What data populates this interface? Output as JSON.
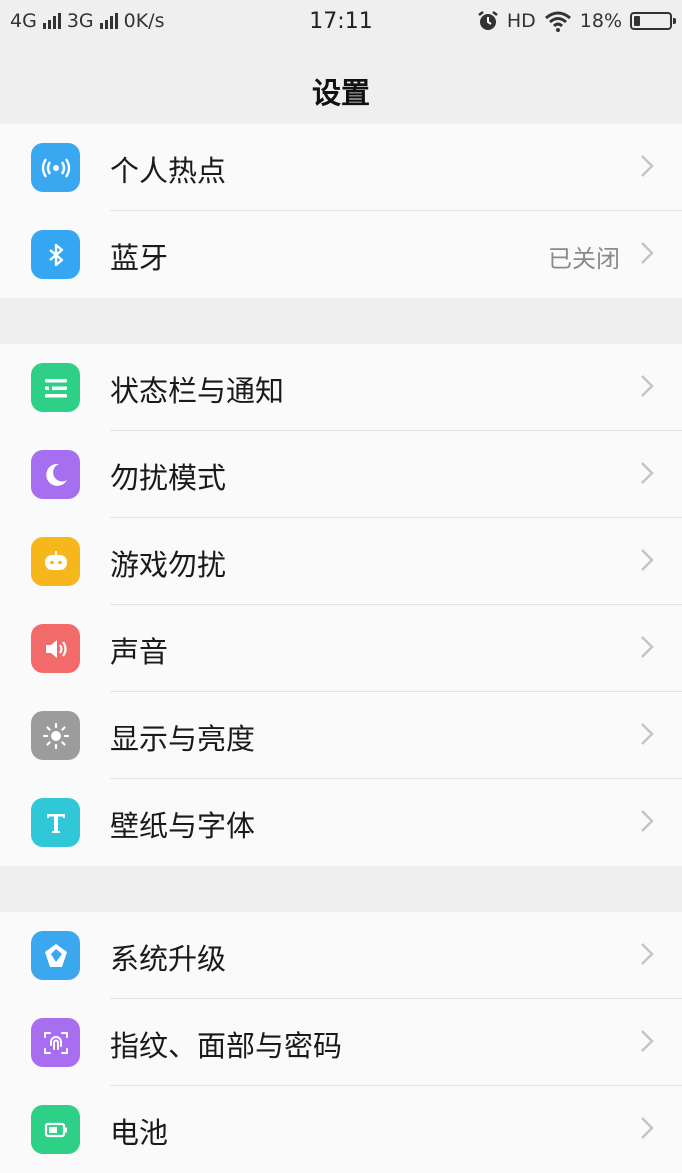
{
  "status_bar": {
    "net1": "4G",
    "net2": "3G",
    "speed": "0K/s",
    "time": "17:11",
    "hd": "HD",
    "battery": "18%"
  },
  "header": {
    "title": "设置"
  },
  "groups": [
    {
      "items": [
        {
          "label": "个人热点",
          "value": "",
          "icon": "hotspot-icon",
          "color": "#3aa8f0"
        },
        {
          "label": "蓝牙",
          "value": "已关闭",
          "icon": "bluetooth-icon",
          "color": "#35a6f2"
        }
      ]
    },
    {
      "items": [
        {
          "label": "状态栏与通知",
          "value": "",
          "icon": "notification-icon",
          "color": "#2ecf86"
        },
        {
          "label": "勿扰模式",
          "value": "",
          "icon": "moon-icon",
          "color": "#a56ff0"
        },
        {
          "label": "游戏勿扰",
          "value": "",
          "icon": "gamepad-icon",
          "color": "#f6b71c"
        },
        {
          "label": "声音",
          "value": "",
          "icon": "speaker-icon",
          "color": "#f26a6a"
        },
        {
          "label": "显示与亮度",
          "value": "",
          "icon": "brightness-icon",
          "color": "#9c9c9c"
        },
        {
          "label": "壁纸与字体",
          "value": "",
          "icon": "font-icon",
          "color": "#30c7d8"
        }
      ]
    },
    {
      "items": [
        {
          "label": "系统升级",
          "value": "",
          "icon": "system-update-icon",
          "color": "#3aa7ee"
        },
        {
          "label": "指纹、面部与密码",
          "value": "",
          "icon": "fingerprint-icon",
          "color": "#a86ef0"
        },
        {
          "label": "电池",
          "value": "",
          "icon": "battery-icon",
          "color": "#2ecf86"
        }
      ]
    }
  ]
}
